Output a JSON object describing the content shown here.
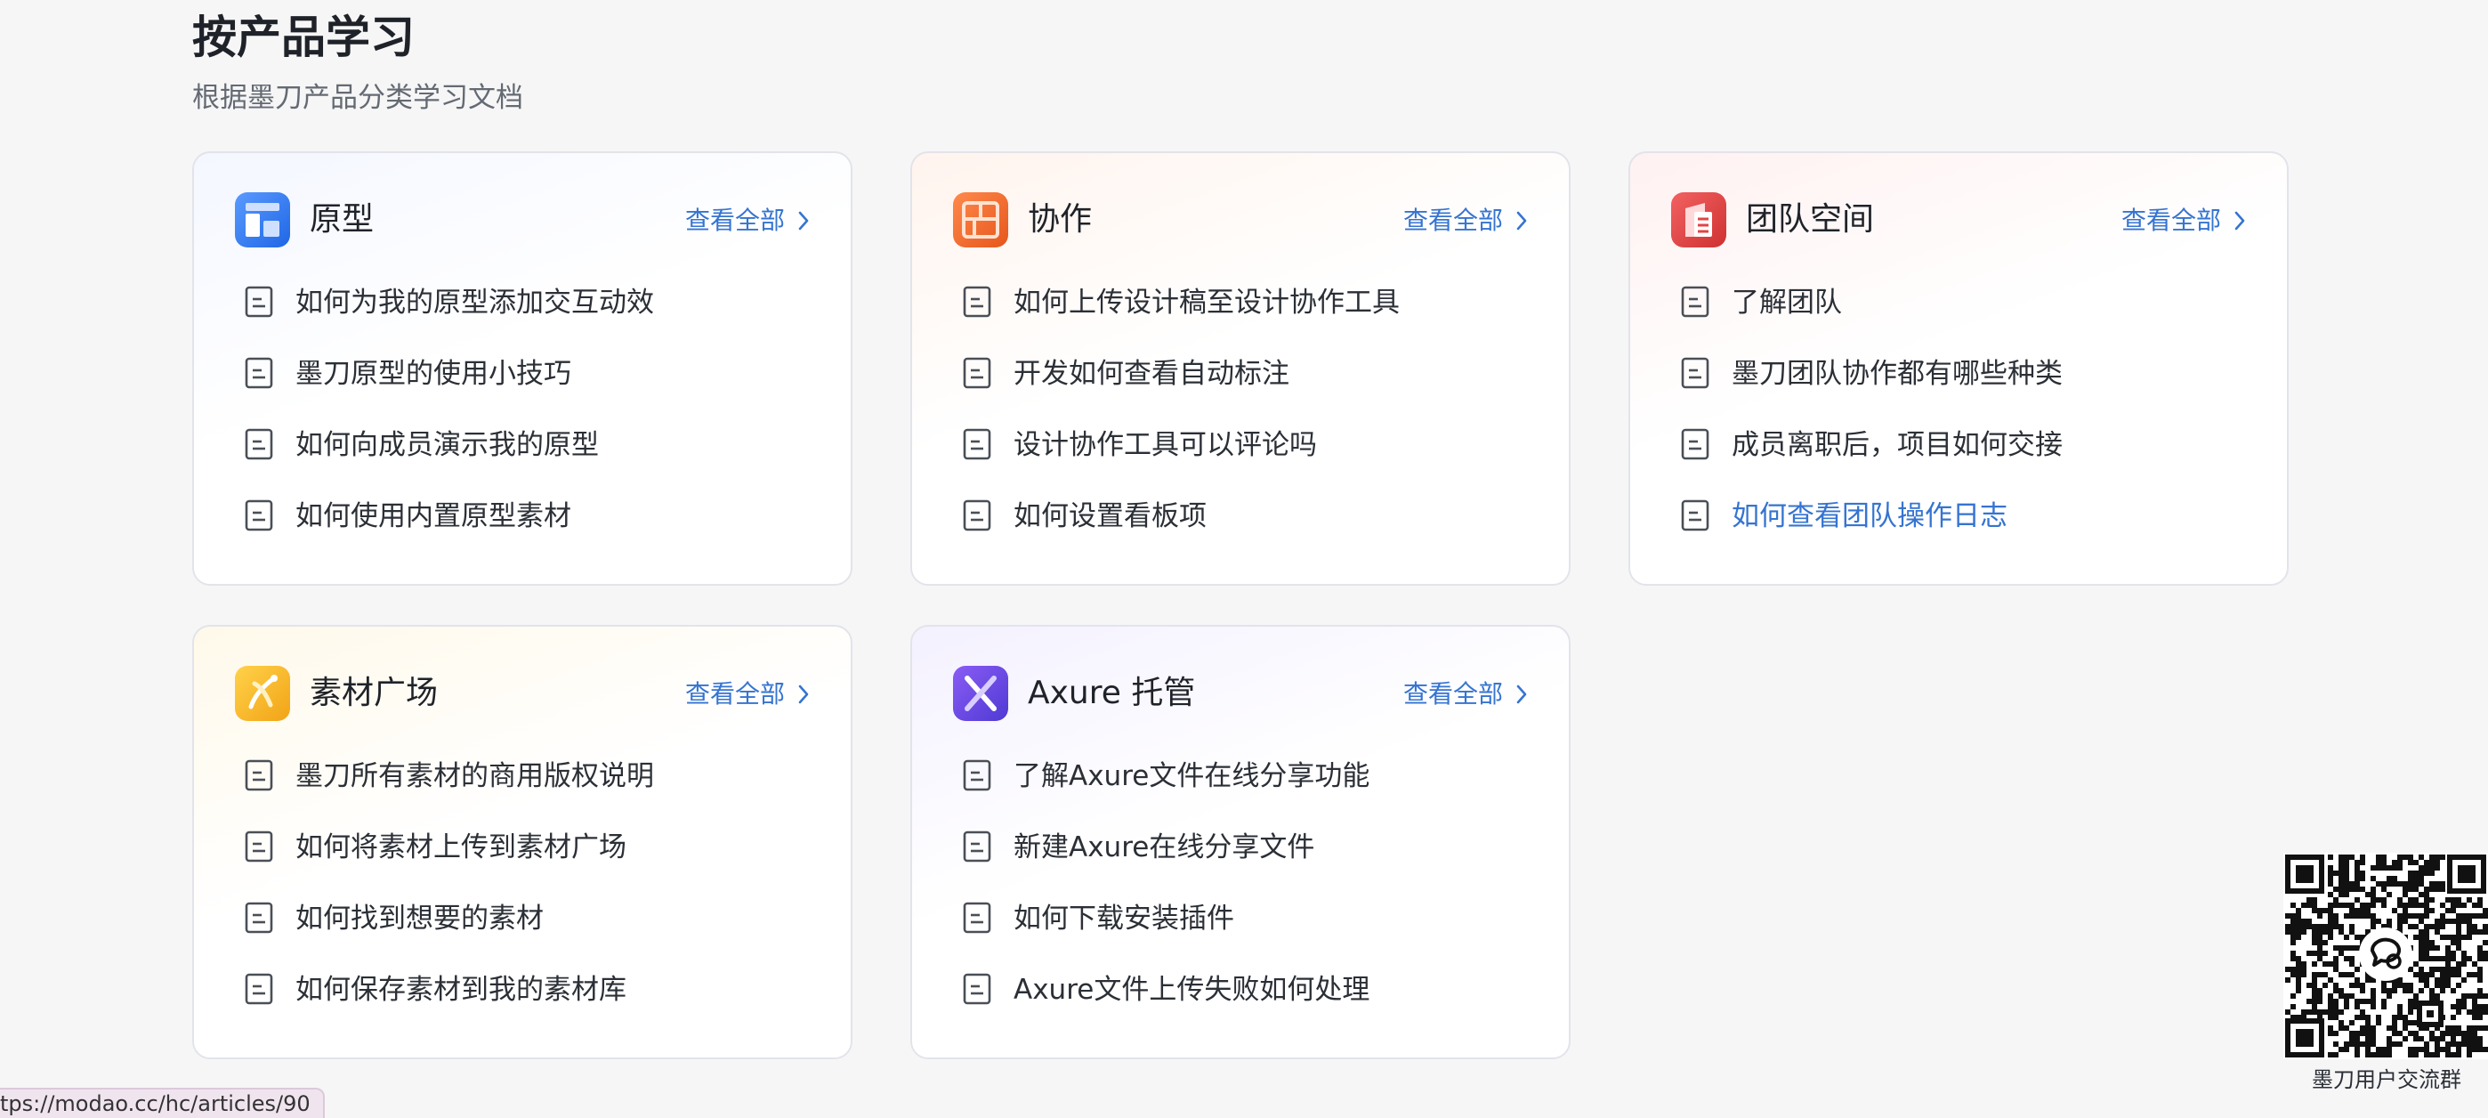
{
  "section": {
    "title": "按产品学习",
    "subtitle": "根据墨刀产品分类学习文档"
  },
  "view_all_label": "查看全部",
  "cards": [
    {
      "title": "原型",
      "icon": "prototype-icon",
      "icon_color": "#2f7cf6",
      "items": [
        "如何为我的原型添加交互动效",
        "墨刀原型的使用小技巧",
        "如何向成员演示我的原型",
        "如何使用内置原型素材"
      ]
    },
    {
      "title": "协作",
      "icon": "collaboration-icon",
      "icon_color": "#ec6a2c",
      "items": [
        "如何上传设计稿至设计协作工具",
        "开发如何查看自动标注",
        "设计协作工具可以评论吗",
        "如何设置看板项"
      ]
    },
    {
      "title": "团队空间",
      "icon": "team-space-icon",
      "icon_color": "#e04545",
      "items": [
        "了解团队",
        "墨刀团队协作都有哪些种类",
        "成员离职后，项目如何交接",
        "如何查看团队操作日志"
      ]
    },
    {
      "title": "素材广场",
      "icon": "material-square-icon",
      "icon_color": "#f5b72a",
      "items": [
        "墨刀所有素材的商用版权说明",
        "如何将素材上传到素材广场",
        "如何找到想要的素材",
        "如何保存素材到我的素材库"
      ]
    },
    {
      "title": "Axure 托管",
      "icon": "axure-icon",
      "icon_color": "#6c4ce0",
      "items": [
        "了解Axure文件在线分享功能",
        "新建Axure在线分享文件",
        "如何下载安装插件",
        "Axure文件上传失败如何处理"
      ]
    }
  ],
  "qr": {
    "caption": "墨刀用户交流群"
  },
  "status_bar": {
    "url": "tps://modao.cc/hc/articles/90"
  }
}
